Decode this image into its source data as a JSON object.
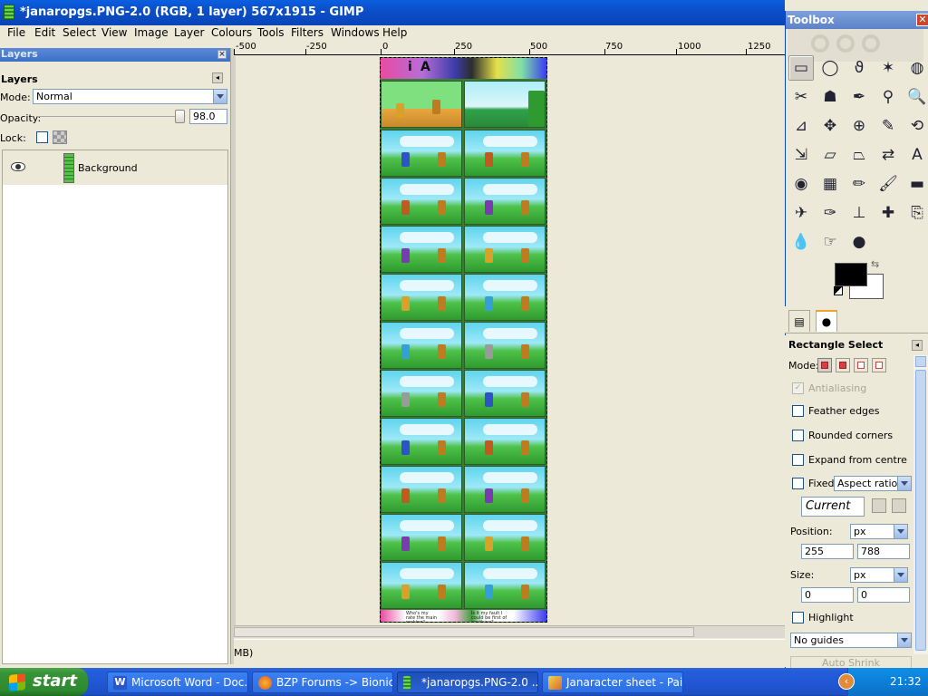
{
  "window": {
    "title": "*janaropgs.PNG-2.0 (RGB, 1 layer) 567x1915 - GIMP",
    "controls": [
      "_",
      "□",
      "✕"
    ]
  },
  "menubar": [
    "File",
    "Edit",
    "Select",
    "View",
    "Image",
    "Layer",
    "Colours",
    "Tools",
    "Filters",
    "Windows",
    "Help"
  ],
  "ruler": {
    "labels": [
      "-500",
      "-250",
      "0",
      "250",
      "500",
      "750",
      "1000",
      "1250"
    ]
  },
  "layers_dock": {
    "title": "Layers",
    "subtitle": "Layers",
    "mode_label": "Mode:",
    "mode_value": "Normal",
    "opacity_label": "Opacity:",
    "opacity_value": "98.0",
    "lock_label": "Lock:",
    "layers": [
      {
        "name": "Background",
        "visible": true
      }
    ]
  },
  "canvas": {
    "banner_letters": [
      "i",
      "A"
    ],
    "bottom_caption_left": "Who's my rate the main rocking?",
    "bottom_caption_right": "Is it my fault I could be first of anything?"
  },
  "status": {
    "text": "MB)"
  },
  "toolbox": {
    "title": "Toolbox",
    "tools": [
      "rect-select-icon",
      "ellipse-select-icon",
      "lasso-icon",
      "fuzzy-select-icon",
      "select-by-color-icon",
      "scissors-icon",
      "foreground-select-icon",
      "paths-icon",
      "color-picker-icon",
      "zoom-icon",
      "measure-icon",
      "move-icon",
      "align-icon",
      "crop-icon",
      "rotate-icon",
      "scale-icon",
      "shear-icon",
      "perspective-icon",
      "flip-icon",
      "text-icon",
      "bucket-fill-icon",
      "blend-icon",
      "pencil-icon",
      "paintbrush-icon",
      "eraser-icon",
      "airbrush-icon",
      "ink-icon",
      "clone-icon",
      "heal-icon",
      "perspective-clone-icon",
      "blur-icon",
      "smudge-icon",
      "dodge-burn-icon"
    ],
    "tool_glyphs": [
      "▭",
      "◯",
      "ϑ",
      "✶",
      "◍",
      "✂",
      "☗",
      "✒",
      "⚲",
      "🔍",
      "⊿",
      "✥",
      "⊕",
      "✎",
      "⟲",
      "⇲",
      "▱",
      "⏢",
      "⇄",
      "A",
      "◉",
      "▦",
      "✏",
      "🖌",
      "▬",
      "✈",
      "✑",
      "⊥",
      "✚",
      "⎘",
      "💧",
      "☞",
      "●"
    ],
    "fg_color": "#000000",
    "bg_color": "#ffffff"
  },
  "tool_options": {
    "title": "Rectangle Select",
    "mode_label": "Mode:",
    "antialiasing": {
      "label": "Antialiasing",
      "checked": true,
      "disabled": true
    },
    "feather_edges": {
      "label": "Feather edges",
      "checked": false
    },
    "rounded_corners": {
      "label": "Rounded corners",
      "checked": false
    },
    "expand_from_centre": {
      "label": "Expand from centre",
      "checked": false
    },
    "fixed": {
      "label": "Fixed:",
      "checked": false,
      "value": "Aspect ratio"
    },
    "current_value": "Current",
    "position_label": "Position:",
    "position_unit": "px",
    "position_x": "255",
    "position_y": "788",
    "size_label": "Size:",
    "size_unit": "px",
    "size_w": "0",
    "size_h": "0",
    "highlight": {
      "label": "Highlight",
      "checked": false
    },
    "guides": "No guides",
    "auto_shrink": "Auto Shrink"
  },
  "taskbar": {
    "start": "start",
    "tasks": [
      {
        "label": "Microsoft Word - Doc...",
        "icon": "word-icon",
        "active": false
      },
      {
        "label": "BZP Forums -> Bionicl...",
        "icon": "firefox-icon",
        "active": false
      },
      {
        "label": "*janaropgs.PNG-2.0 ...",
        "icon": "gimp-icon",
        "active": true
      },
      {
        "label": "Janaracter sheet - Paint",
        "icon": "paint-icon",
        "active": false
      }
    ],
    "clock": "21:32"
  }
}
